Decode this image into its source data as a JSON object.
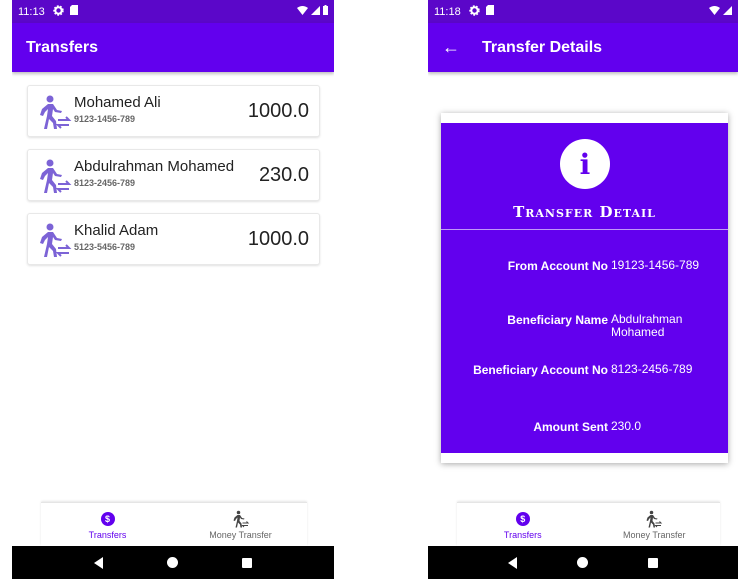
{
  "left_screen": {
    "status": {
      "time": "11:13"
    },
    "appbar": {
      "title": "Transfers"
    },
    "transfers": [
      {
        "name": "Mohamed Ali",
        "account": "9123-1456-789",
        "amount": "1000.0"
      },
      {
        "name": "Abdulrahman Mohamed",
        "account": "8123-2456-789",
        "amount": "230.0"
      },
      {
        "name": "Khalid Adam",
        "account": "5123-5456-789",
        "amount": "1000.0"
      }
    ],
    "bottom_nav": [
      {
        "label": "Transfers",
        "icon": "dollar-icon",
        "active": true
      },
      {
        "label": "Money Transfer",
        "icon": "walking-transfer-icon",
        "active": false
      }
    ]
  },
  "right_screen": {
    "status": {
      "time": "11:18"
    },
    "appbar": {
      "title": "Transfer Details"
    },
    "detail": {
      "title": "Transfer Detail",
      "rows": [
        {
          "label": "From Account No",
          "value": "19123-1456-789"
        },
        {
          "label": "Beneficiary Name",
          "value": "Abdulrahman Mohamed"
        },
        {
          "label": "Beneficiary Account No",
          "value": "8123-2456-789"
        },
        {
          "label": "Amount Sent",
          "value": "230.0"
        }
      ]
    },
    "bottom_nav": [
      {
        "label": "Transfers",
        "icon": "dollar-icon",
        "active": true
      },
      {
        "label": "Money Transfer",
        "icon": "walking-transfer-icon",
        "active": false
      }
    ]
  },
  "colors": {
    "primary": "#6200ee",
    "status_bar": "#5b07c9",
    "icon_tint": "#7c63d6"
  }
}
